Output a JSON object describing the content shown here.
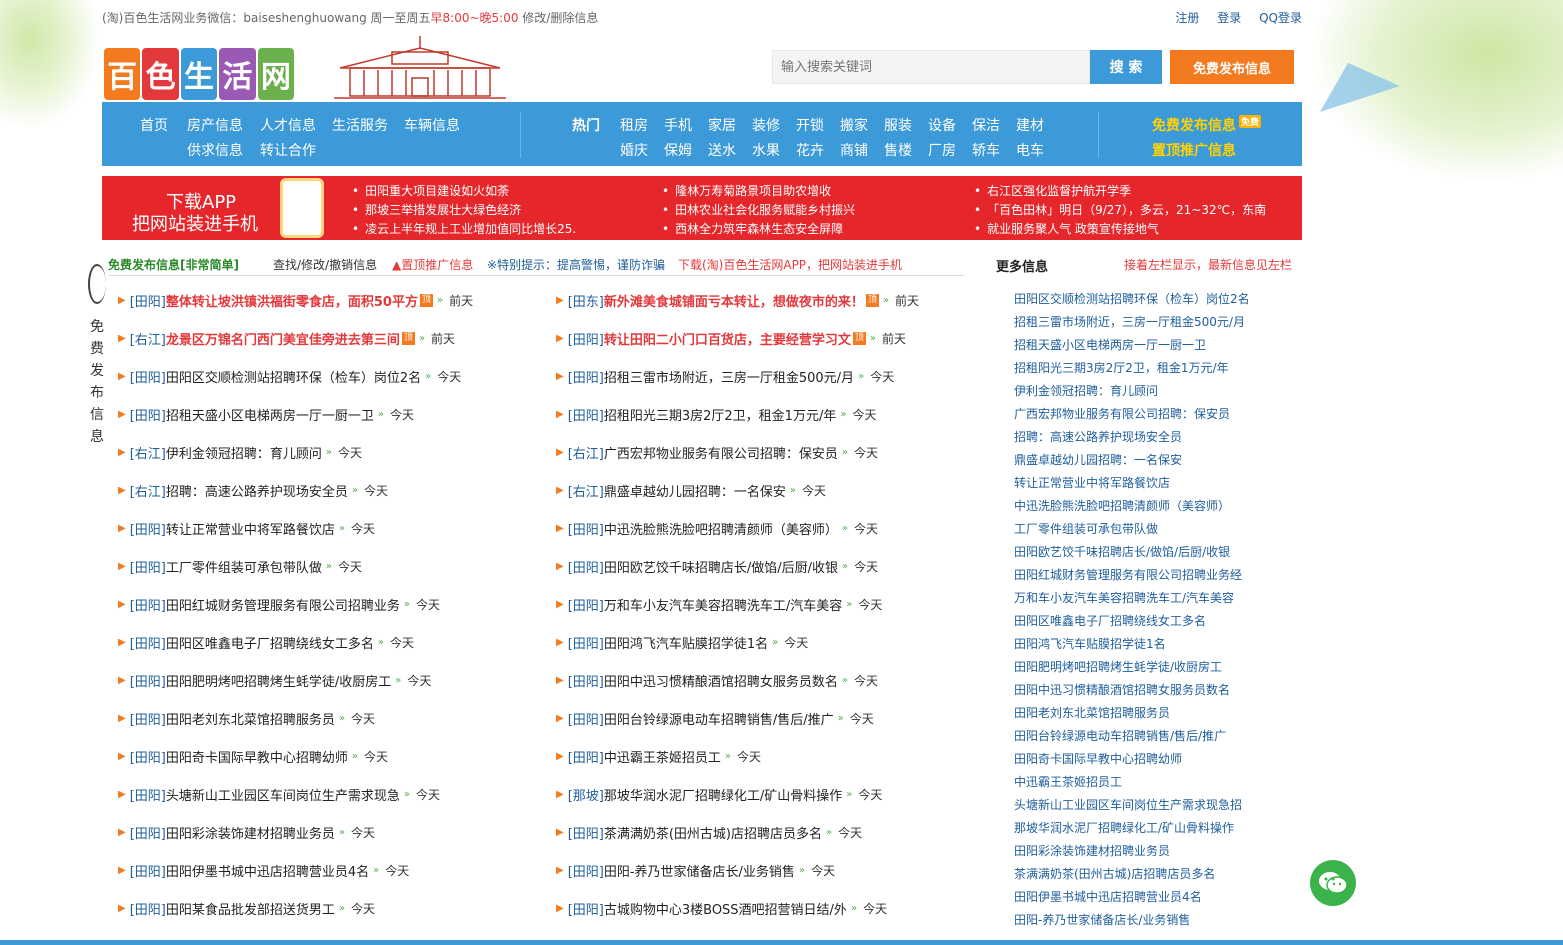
{
  "topbar": {
    "notice_prefix": "(淘)百色生活网业务微信：baiseshenghuowang 周一至周五",
    "notice_hours": "早8:00~晚5:00",
    "notice_suffix": " 修改/删除信息",
    "register": "注册",
    "login": "登录",
    "qq_login": "QQ登录"
  },
  "logo": {
    "chars": [
      "百",
      "色",
      "生",
      "活",
      "网"
    ],
    "colors": [
      "#f47a1f",
      "#e4393c",
      "#3d9ad8",
      "#9b59b6",
      "#6ab04c"
    ]
  },
  "search": {
    "placeholder": "输入搜索关键词",
    "button": "搜 索",
    "publish": "免费发布信息"
  },
  "nav": {
    "main_row1": [
      "首页",
      "房产信息",
      "人才信息",
      "生活服务",
      "车辆信息"
    ],
    "main_row2": [
      "供求信息",
      "转让合作"
    ],
    "hot": "热门",
    "hot_row1": [
      "租房",
      "手机",
      "家居",
      "装修",
      "开锁",
      "搬家",
      "服装",
      "设备",
      "保洁",
      "建材"
    ],
    "hot_row2": [
      "婚庆",
      "保姆",
      "送水",
      "水果",
      "花卉",
      "商铺",
      "售楼",
      "厂房",
      "轿车",
      "电车"
    ],
    "publish": "免费发布信息",
    "badge": "免费",
    "top_promo": "置顶推广信息"
  },
  "banner": {
    "app_line1": "下载APP",
    "app_line2": "把网站装进手机",
    "news": [
      [
        "田阳重大项目建设如火如荼",
        "那坡三举措发展壮大绿色经济",
        "凌云上半年规上工业增加值同比增长25."
      ],
      [
        "隆林万寿菊路景项目助农增收",
        "田林农业社会化服务赋能乡村振兴",
        "西林全力筑牢森林生态安全屏障"
      ],
      [
        "右江区强化监督护航开学季",
        "「百色田林」明日（9/27），多云，21~32℃，东南",
        "就业服务聚人气 政策宣传接地气"
      ]
    ]
  },
  "subbar": {
    "free_publish": "免费发布信息[非常简单]",
    "edit": "查找/修改/撤销信息",
    "top": "▲置顶推广信息",
    "tip": "※特别提示：提高警惕，谨防诈骗",
    "download": "下载(淘)百色生活网APP，把网站装进手机"
  },
  "side_text": [
    "免",
    "费",
    "发",
    "布",
    "信",
    "息"
  ],
  "listings_left": [
    {
      "loc": "[田阳]",
      "title": "整体转让坡洪镇洪福街零食店，面积50平方",
      "red": true,
      "time": "前天"
    },
    {
      "loc": "[右江]",
      "title": "龙景区万锦名门西门美宜佳旁进去第三间",
      "red": true,
      "time": "前天"
    },
    {
      "loc": "[田阳]",
      "title": "田阳区交顺检测站招聘环保（检车）岗位2名",
      "red": false,
      "time": "今天"
    },
    {
      "loc": "[田阳]",
      "title": "招租天盛小区电梯两房一厅一厨一卫",
      "red": false,
      "time": "今天"
    },
    {
      "loc": "[右江]",
      "title": "伊利金领冠招聘：育儿顾问",
      "red": false,
      "time": "今天"
    },
    {
      "loc": "[右江]",
      "title": "招聘：高速公路养护现场安全员",
      "red": false,
      "time": "今天"
    },
    {
      "loc": "[田阳]",
      "title": "转让正常营业中将军路餐饮店",
      "red": false,
      "time": "今天"
    },
    {
      "loc": "[田阳]",
      "title": "工厂零件组装可承包带队做",
      "red": false,
      "time": "今天"
    },
    {
      "loc": "[田阳]",
      "title": "田阳红城财务管理服务有限公司招聘业务",
      "red": false,
      "time": "今天"
    },
    {
      "loc": "[田阳]",
      "title": "田阳区唯鑫电子厂招聘绕线女工多名",
      "red": false,
      "time": "今天"
    },
    {
      "loc": "[田阳]",
      "title": "田阳肥明烤吧招聘烤生蚝学徒/收厨房工",
      "red": false,
      "time": "今天"
    },
    {
      "loc": "[田阳]",
      "title": "田阳老刘东北菜馆招聘服务员",
      "red": false,
      "time": "今天"
    },
    {
      "loc": "[田阳]",
      "title": "田阳奇卡国际早教中心招聘幼师",
      "red": false,
      "time": "今天"
    },
    {
      "loc": "[田阳]",
      "title": "头塘新山工业园区车间岗位生产需求现急",
      "red": false,
      "time": "今天"
    },
    {
      "loc": "[田阳]",
      "title": "田阳彩涂装饰建材招聘业务员",
      "red": false,
      "time": "今天"
    },
    {
      "loc": "[田阳]",
      "title": "田阳伊墨书城中迅店招聘营业员4名",
      "red": false,
      "time": "今天"
    },
    {
      "loc": "[田阳]",
      "title": "田阳某食品批发部招送货男工",
      "red": false,
      "time": "今天"
    }
  ],
  "listings_right": [
    {
      "loc": "[田东]",
      "title": "新外滩美食城铺面亏本转让，想做夜市的来！",
      "red": true,
      "time": "前天"
    },
    {
      "loc": "[田阳]",
      "title": "转让田阳二小门口百货店，主要经营学习文",
      "red": true,
      "time": "前天"
    },
    {
      "loc": "[田阳]",
      "title": "招租三雷市场附近，三房一厅租金500元/月",
      "red": false,
      "time": "今天"
    },
    {
      "loc": "[田阳]",
      "title": "招租阳光三期3房2厅2卫，租金1万元/年",
      "red": false,
      "time": "今天"
    },
    {
      "loc": "[右江]",
      "title": "广西宏邦物业服务有限公司招聘：保安员",
      "red": false,
      "time": "今天"
    },
    {
      "loc": "[右江]",
      "title": "鼎盛卓越幼儿园招聘：一名保安",
      "red": false,
      "time": "今天"
    },
    {
      "loc": "[田阳]",
      "title": "中迅洗脸熊洗脸吧招聘清颜师（美容师）",
      "red": false,
      "time": "今天"
    },
    {
      "loc": "[田阳]",
      "title": "田阳欧艺饺千味招聘店长/做馅/后厨/收银",
      "red": false,
      "time": "今天"
    },
    {
      "loc": "[田阳]",
      "title": "万和车小友汽车美容招聘洗车工/汽车美容",
      "red": false,
      "time": "今天"
    },
    {
      "loc": "[田阳]",
      "title": "田阳鸿飞汽车贴膜招学徒1名",
      "red": false,
      "time": "今天"
    },
    {
      "loc": "[田阳]",
      "title": "田阳中迅习惯精酿酒馆招聘女服务员数名",
      "red": false,
      "time": "今天"
    },
    {
      "loc": "[田阳]",
      "title": "田阳台铃绿源电动车招聘销售/售后/推广",
      "red": false,
      "time": "今天"
    },
    {
      "loc": "[田阳]",
      "title": "中迅霸王茶姬招员工",
      "red": false,
      "time": "今天"
    },
    {
      "loc": "[那坡]",
      "title": "那坡华润水泥厂招聘绿化工/矿山骨料操作",
      "red": false,
      "time": "今天"
    },
    {
      "loc": "[田阳]",
      "title": "茶满满奶茶(田州古城)店招聘店员多名",
      "red": false,
      "time": "今天"
    },
    {
      "loc": "[田阳]",
      "title": "田阳-养乃世家储备店长/业务销售",
      "red": false,
      "time": "今天"
    },
    {
      "loc": "[田阳]",
      "title": "古城购物中心3楼BOSS酒吧招营销日结/外",
      "red": false,
      "time": "今天"
    }
  ],
  "more": {
    "title": "更多信息",
    "note": "接着左栏显示，最新信息见左栏",
    "items": [
      "田阳区交顺检测站招聘环保（检车）岗位2名",
      "招租三雷市场附近，三房一厅租金500元/月",
      "招租天盛小区电梯两房一厅一厨一卫",
      "招租阳光三期3房2厅2卫，租金1万元/年",
      "伊利金领冠招聘：育儿顾问",
      "广西宏邦物业服务有限公司招聘：保安员",
      "招聘：高速公路养护现场安全员",
      "鼎盛卓越幼儿园招聘：一名保安",
      "转让正常营业中将军路餐饮店",
      "中迅洗脸熊洗脸吧招聘清颜师（美容师）",
      "工厂零件组装可承包带队做",
      "田阳欧艺饺千味招聘店长/做馅/后厨/收银",
      "田阳红城财务管理服务有限公司招聘业务经",
      "万和车小友汽车美容招聘洗车工/汽车美容",
      "田阳区唯鑫电子厂招聘绕线女工多名",
      "田阳鸿飞汽车贴膜招学徒1名",
      "田阳肥明烤吧招聘烤生蚝学徒/收厨房工",
      "田阳中迅习惯精酿酒馆招聘女服务员数名",
      "田阳老刘东北菜馆招聘服务员",
      "田阳台铃绿源电动车招聘销售/售后/推广",
      "田阳奇卡国际早教中心招聘幼师",
      "中迅霸王茶姬招员工",
      "头塘新山工业园区车间岗位生产需求现急招",
      "那坡华润水泥厂招聘绿化工/矿山骨料操作",
      "田阳彩涂装饰建材招聘业务员",
      "茶满满奶茶(田州古城)店招聘店员多名",
      "田阳伊墨书城中迅店招聘营业员4名",
      "田阳-养乃世家储备店长/业务销售"
    ]
  },
  "tags": {
    "top_tag": "顶",
    "chevron": "»"
  }
}
